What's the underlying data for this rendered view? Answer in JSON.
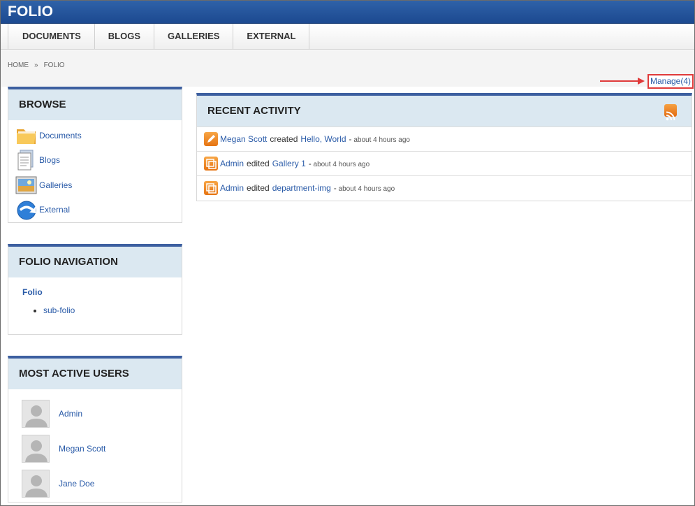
{
  "header": {
    "title": "FOLIO"
  },
  "nav": {
    "tabs": [
      "DOCUMENTS",
      "BLOGS",
      "GALLERIES",
      "EXTERNAL"
    ]
  },
  "breadcrumb": {
    "home": "HOME",
    "separator": "»",
    "current": "FOLIO"
  },
  "manage": {
    "label": "Manage(4)"
  },
  "browse": {
    "title": "BROWSE",
    "items": [
      {
        "label": "Documents",
        "icon": "folder-icon"
      },
      {
        "label": "Blogs",
        "icon": "document-icon"
      },
      {
        "label": "Galleries",
        "icon": "picture-icon"
      },
      {
        "label": "External",
        "icon": "globe-arrow-icon"
      }
    ]
  },
  "folio_nav": {
    "title": "FOLIO NAVIGATION",
    "root": "Folio",
    "children": [
      "sub-folio"
    ]
  },
  "users": {
    "title": "MOST ACTIVE USERS",
    "list": [
      "Admin",
      "Megan Scott",
      "Jane Doe"
    ]
  },
  "activity": {
    "title": "RECENT ACTIVITY",
    "items": [
      {
        "user": "Megan Scott",
        "verb": "created",
        "target": "Hello, World",
        "dash": "-",
        "time": "about 4 hours ago",
        "icon": "pencil-icon"
      },
      {
        "user": "Admin",
        "verb": "edited",
        "target": "Gallery 1",
        "dash": "-",
        "time": "about 4 hours ago",
        "icon": "gallery-icon"
      },
      {
        "user": "Admin",
        "verb": "edited",
        "target": "department-img",
        "dash": "-",
        "time": "about 4 hours ago",
        "icon": "gallery-icon"
      }
    ]
  },
  "colors": {
    "header_blue": "#1c4990",
    "link_blue": "#2a5ba8",
    "panel_bg": "#dbe8f1",
    "highlight_red": "#e03a3a",
    "icon_orange": "#f08a24"
  }
}
